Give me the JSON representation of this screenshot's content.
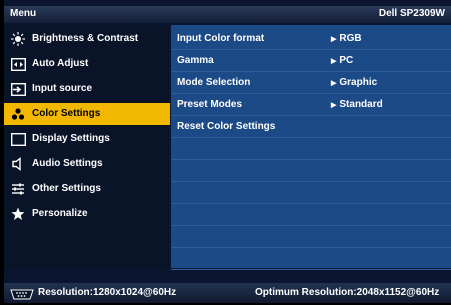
{
  "header": {
    "title": "Menu",
    "model": "Dell SP2309W"
  },
  "menu": [
    {
      "label": "Brightness & Contrast",
      "icon": "brightness-icon"
    },
    {
      "label": "Auto Adjust",
      "icon": "auto-adjust-icon"
    },
    {
      "label": "Input source",
      "icon": "input-source-icon"
    },
    {
      "label": "Color Settings",
      "icon": "color-settings-icon",
      "selected": true
    },
    {
      "label": "Display Settings",
      "icon": "display-icon"
    },
    {
      "label": "Audio Settings",
      "icon": "speaker-icon"
    },
    {
      "label": "Other Settings",
      "icon": "sliders-icon"
    },
    {
      "label": "Personalize",
      "icon": "star-icon"
    }
  ],
  "settings": [
    {
      "label": "Input Color format",
      "value": "RGB"
    },
    {
      "label": "Gamma",
      "value": "PC"
    },
    {
      "label": "Mode Selection",
      "value": "Graphic"
    },
    {
      "label": "Preset Modes",
      "value": "Standard"
    },
    {
      "label": "Reset Color Settings",
      "value": ""
    }
  ],
  "footer": {
    "resolution": "Resolution:1280x1024@60Hz",
    "optimum": "Optimum Resolution:2048x1152@60Hz"
  },
  "colors": {
    "selected": "#f2b800",
    "panel": "#1c4a86",
    "background": "#0a1428"
  }
}
